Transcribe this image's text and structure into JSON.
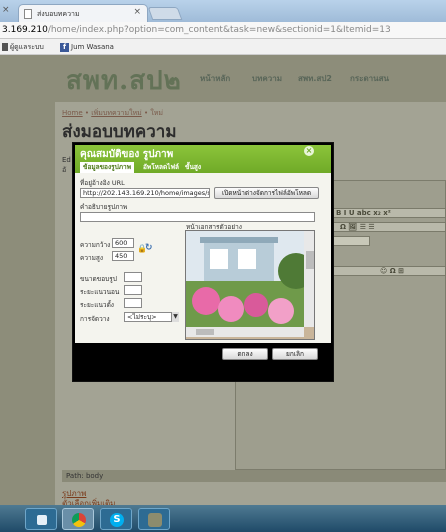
{
  "browser": {
    "tab_title": "ส่งบอบทความ",
    "url_host": "3.169.210",
    "url_path": "/home/index.php?option=com_content&task=new&sectionid=1&Itemid=13",
    "bookmarks": [
      "ผู้ดูแลระบบ",
      "Jum Wasana"
    ]
  },
  "site": {
    "logo": "สพท.สป๒",
    "nav": [
      "หน้าหลัก",
      "บทความ",
      "สพท.สป2",
      "กระดานสน"
    ]
  },
  "page": {
    "breadcrumb": [
      "Home",
      "เพิ่มบทความใหม่",
      "ใหม่"
    ],
    "title": "ส่งมอบบทความ",
    "left_chars": [
      "Ed",
      "อั"
    ],
    "path_label": "Path: body",
    "links": [
      "รูปภาพ",
      "ตัวเลือกเพิ่มเติม"
    ]
  },
  "editor_toolbar": {
    "row1": "B  I  U  abc  x₂  x²",
    "row2": "Ω  🖼  ☰ ☰",
    "row3": "☺  Ω  ⊞"
  },
  "modal": {
    "title": "คุณสมบัติของ รูปภาพ",
    "tabs": [
      "ข้อมูลของรูปภาพ",
      "อัพโหลดไฟล์",
      "ขั้นสูง"
    ],
    "url_label": "ที่อยู่อ้างอิง URL",
    "url_value": "http://202.143.169.210/home/images/stories/",
    "browse_button": "เปิดหน้าต่างจัดการไฟล์อัพโหลด",
    "alt_label": "คำอธิบายรูปภาพ",
    "alt_value": "",
    "width_label": "ความกว้าง",
    "width_value": "600",
    "height_label": "ความสูง",
    "height_value": "450",
    "border_label": "ขนาดขอบรูป",
    "hspace_label": "ระยะแนวนอน",
    "vspace_label": "ระยะแนวตั้ง",
    "align_label": "การจัดวาง",
    "align_value": "<ไม่ระบุ>",
    "preview_label": "หน้าเอกสารตัวอย่าง",
    "ok_button": "ตกลง",
    "cancel_button": "ยกเลิก"
  },
  "colors": {
    "modal_header": "#7cb52f",
    "page_bg": "#8d8d7a",
    "logo": "#637257"
  }
}
